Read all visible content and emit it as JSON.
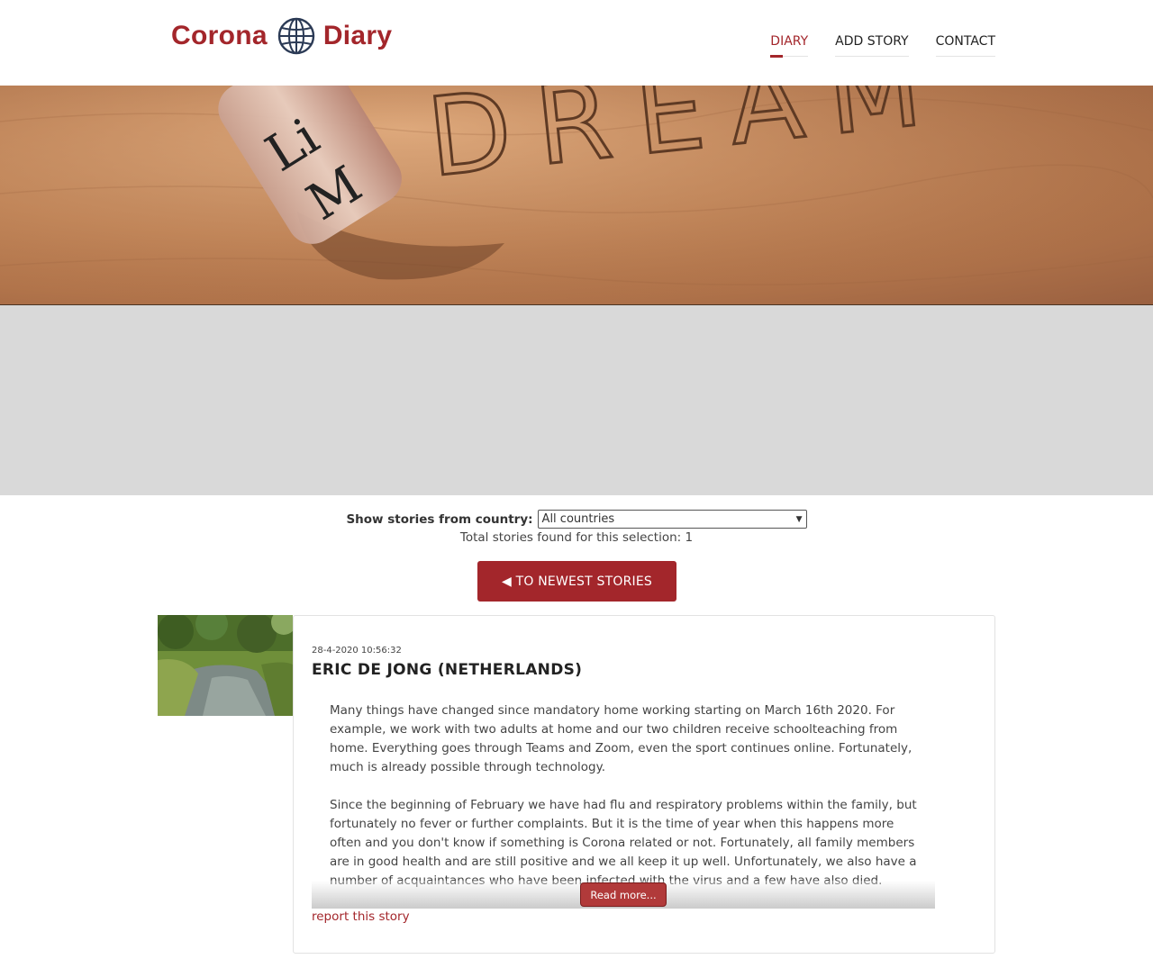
{
  "header": {
    "logo_left": "Corona",
    "logo_right": "Diary",
    "logo_icon": "globe-icon",
    "nav": [
      {
        "label": "DIARY",
        "active": true
      },
      {
        "label": "ADD STORY",
        "active": false
      },
      {
        "label": "CONTACT",
        "active": false
      }
    ]
  },
  "hero": {
    "image": "sand-writing-dream-bottle",
    "sand_text": "DREAM"
  },
  "filter": {
    "label": "Show stories from country:",
    "selected": "All countries",
    "total_text": "Total stories found for this selection: 1"
  },
  "newest_button": "◀ TO NEWEST STORIES",
  "story": {
    "thumbnail": "river-landscape-photo",
    "date": "28-4-2020 10:56:32",
    "title": "ERIC DE JONG (NETHERLANDS)",
    "paragraphs": [
      "Many things have changed since mandatory home working starting on March 16th 2020. For example, we work with two adults at home and our two children receive schoolteaching from home. Everything goes through Teams and Zoom, even the sport continues online. Fortunately, much is already possible through technology.",
      "Since the beginning of February we have had flu and respiratory problems within the family, but fortunately no fever or further complaints. But it is the time of year when this happens more often and you don't know if something is Corona related or not. Fortunately, all family members are in good health and are still positive and we all keep it up well. Unfortunately, we also have a number of acquaintances who have been infected with the virus and a few have also died."
    ],
    "read_more": "Read more...",
    "report": "report this story"
  },
  "colors": {
    "brand": "#a3262b",
    "band": "#d9d9d9"
  }
}
